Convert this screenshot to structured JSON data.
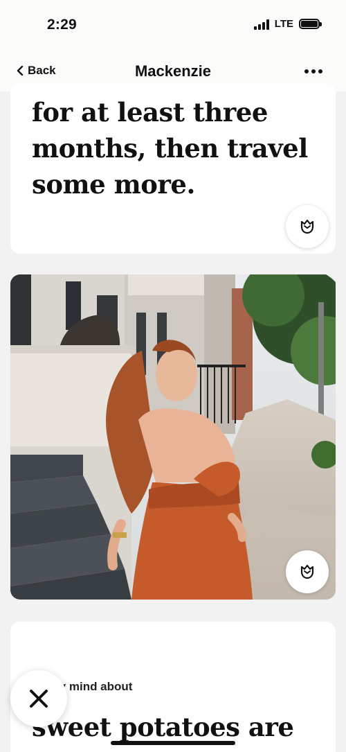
{
  "status_bar": {
    "time": "2:29",
    "network": "LTE"
  },
  "nav": {
    "back_label": "Back",
    "title": "Mackenzie"
  },
  "cards": {
    "text_answer": "for at least three months, then travel some more.",
    "prompt_label": "ge my mind about",
    "prompt_answer": "sweet potatoes are"
  },
  "icons": {
    "back": "chevron-left-icon",
    "more": "more-dots-icon",
    "like": "rose-icon",
    "skip": "close-x-icon"
  },
  "colors": {
    "dress": "#c55a2b",
    "hair": "#a8542a",
    "background": "#f2f2f2"
  }
}
